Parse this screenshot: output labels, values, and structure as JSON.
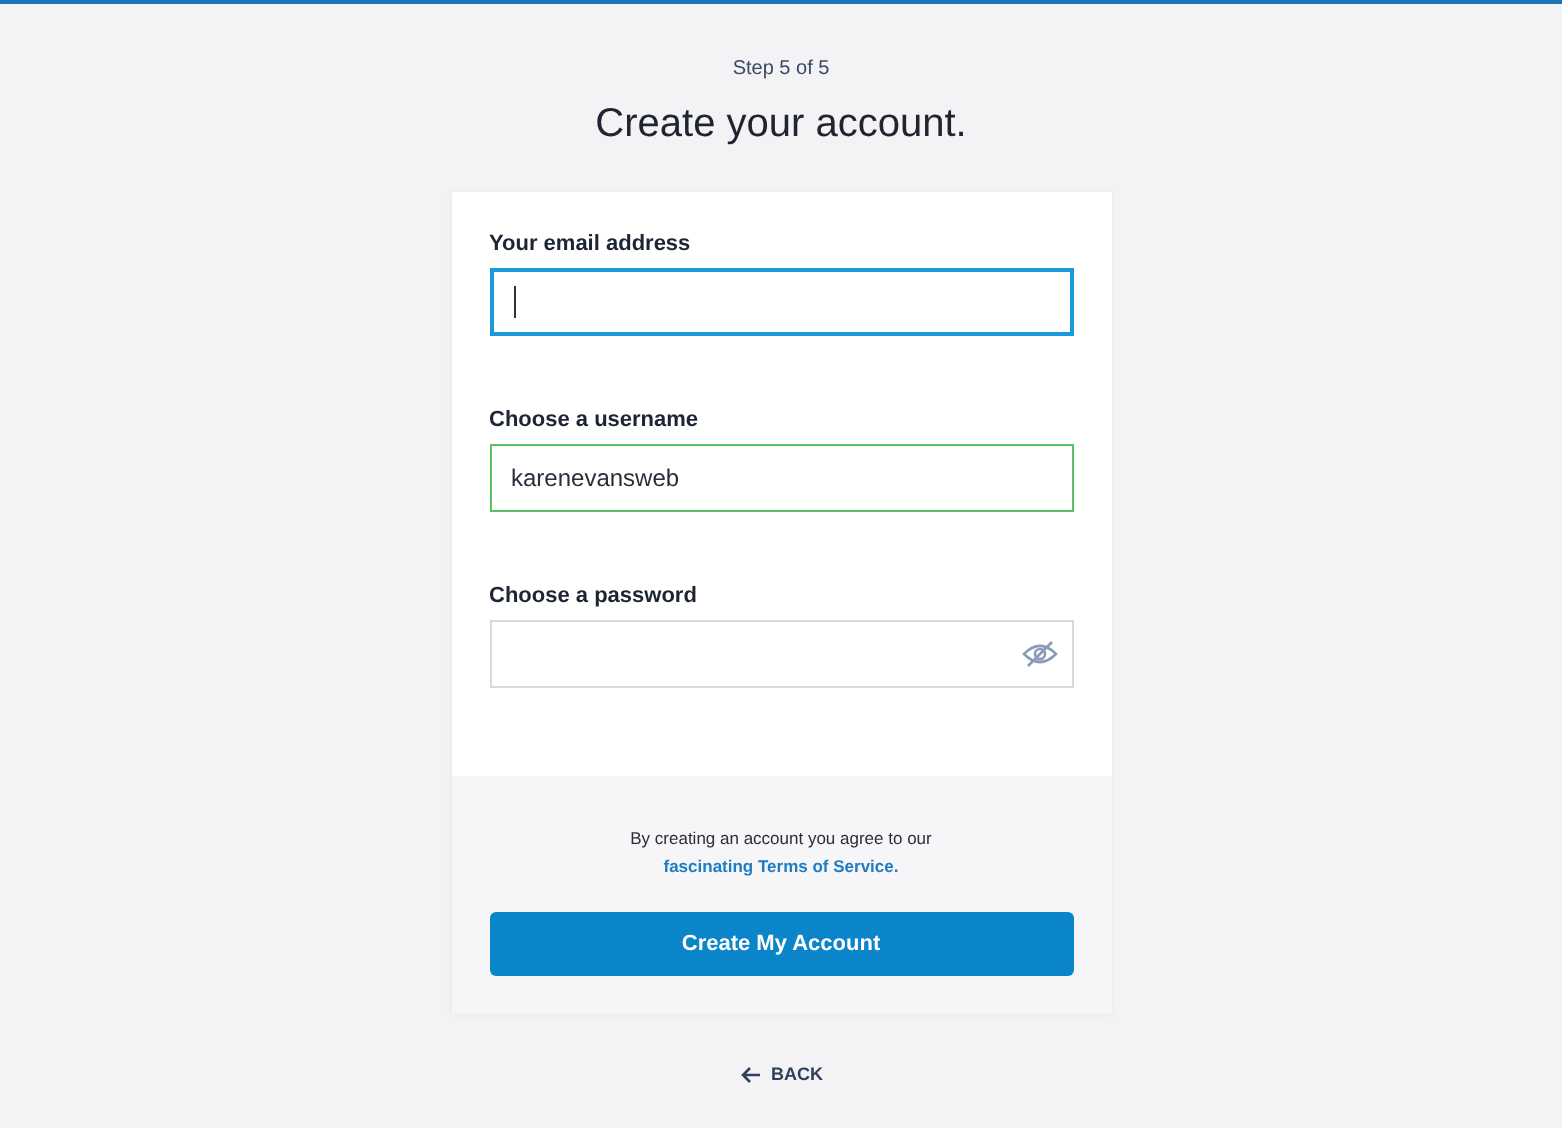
{
  "step": "Step 5 of 5",
  "title": "Create your account.",
  "fields": [
    {
      "label": "Your email address",
      "kind": "text",
      "focused": true,
      "valid": false
    },
    {
      "label": "Choose a username",
      "kind": "text",
      "value": "karenevansweb",
      "focused": false,
      "valid": true
    },
    {
      "label": "Choose a password",
      "kind": "password",
      "focused": false,
      "valid": false
    }
  ],
  "agreement": {
    "text": "By creating an account you agree to our",
    "link": "fascinating Terms of Service."
  },
  "submit_button": "Create My Account",
  "back_link": "BACK"
}
